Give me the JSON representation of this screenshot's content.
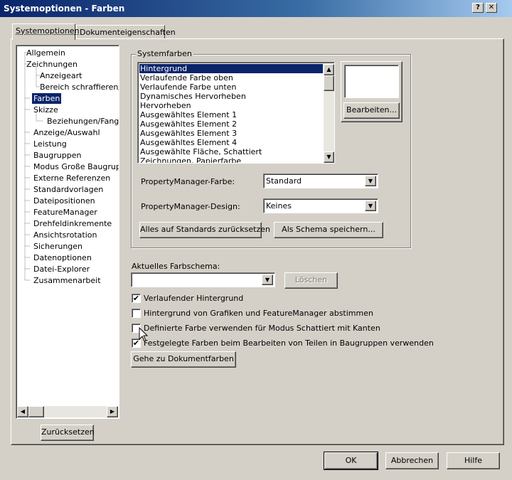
{
  "window": {
    "title": "Systemoptionen - Farben",
    "help_glyph": "?",
    "close_glyph": "✕"
  },
  "tabs": [
    {
      "label": "Systemoptionen",
      "active": true
    },
    {
      "label": "Dokumenteigenschaften",
      "active": false
    }
  ],
  "tree": {
    "items": [
      {
        "label": "Allgemein",
        "level": 1
      },
      {
        "label": "Zeichnungen",
        "level": 1
      },
      {
        "label": "Anzeigeart",
        "level": 2
      },
      {
        "label": "Bereich schraffieren/",
        "level": 2
      },
      {
        "label": "Farben",
        "level": 1,
        "selected": true
      },
      {
        "label": "Skizze",
        "level": 1
      },
      {
        "label": "Beziehungen/Fangen",
        "level": 2
      },
      {
        "label": "Anzeige/Auswahl",
        "level": 1
      },
      {
        "label": "Leistung",
        "level": 1
      },
      {
        "label": "Baugruppen",
        "level": 1
      },
      {
        "label": "Modus Große Baugruppe",
        "level": 1
      },
      {
        "label": "Externe Referenzen",
        "level": 1
      },
      {
        "label": "Standardvorlagen",
        "level": 1
      },
      {
        "label": "Dateipositionen",
        "level": 1
      },
      {
        "label": "FeatureManager",
        "level": 1
      },
      {
        "label": "Drehfeldinkremente",
        "level": 1
      },
      {
        "label": "Ansichtsrotation",
        "level": 1
      },
      {
        "label": "Sicherungen",
        "level": 1
      },
      {
        "label": "Datenoptionen",
        "level": 1
      },
      {
        "label": "Datei-Explorer",
        "level": 1
      },
      {
        "label": "Zusammenarbeit",
        "level": 1
      }
    ],
    "reset_label": "Zurücksetzen"
  },
  "systemfarben": {
    "legend": "Systemfarben",
    "items": [
      "Hintergrund",
      "Verlaufende Farbe oben",
      "Verlaufende Farbe unten",
      "Dynamisches Hervorheben",
      "Hervorheben",
      "Ausgewähltes Element 1",
      "Ausgewähltes Element 2",
      "Ausgewähltes Element 3",
      "Ausgewähltes Element 4",
      "Ausgewählte Fläche, Schattiert",
      "Zeichnungen, Papierfarbe"
    ],
    "selected_index": 0,
    "preview_color": "#ffffff",
    "edit_label": "Bearbeiten...",
    "pm_color_label": "PropertyManager-Farbe:",
    "pm_color_value": "Standard",
    "pm_design_label": "PropertyManager-Design:",
    "pm_design_value": "Keines",
    "reset_all_label": "Alles auf Standards zurücksetzen",
    "save_scheme_label": "Als Schema speichern..."
  },
  "schema": {
    "label": "Aktuelles Farbschema:",
    "value": "",
    "delete_label": "Löschen"
  },
  "options": [
    {
      "label": "Verlaufender Hintergrund",
      "checked": true
    },
    {
      "label": "Hintergrund von Grafiken und FeatureManager abstimmen",
      "checked": false
    },
    {
      "label": "Definierte Farbe verwenden für Modus Schattiert mit Kanten",
      "checked": false
    },
    {
      "label": "Festgelegte Farben beim Bearbeiten von Teilen in Baugruppen verwenden",
      "checked": true
    }
  ],
  "goto_doc_colors_label": "Gehe zu Dokumentfarben",
  "footer": {
    "ok_label": "OK",
    "cancel_label": "Abbrechen",
    "help_label": "Hilfe"
  },
  "glyphs": {
    "check": "✔",
    "arrow_down": "▼",
    "arrow_up": "▲",
    "arrow_left": "◀",
    "arrow_right": "▶"
  },
  "colors": {
    "selection": "#0a246a",
    "face": "#d4d0c8"
  }
}
